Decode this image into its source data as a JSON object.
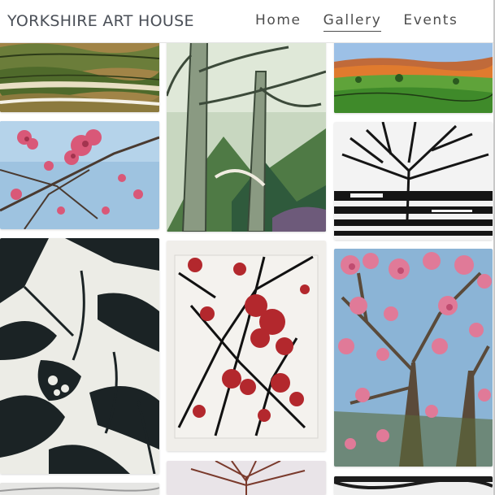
{
  "site": {
    "title": "YORKSHIRE ART HOUSE"
  },
  "nav": {
    "items": [
      {
        "label": "Home",
        "active": false
      },
      {
        "label": "Gallery",
        "active": true
      },
      {
        "label": "Events",
        "active": false
      }
    ]
  },
  "gallery": {
    "artworks": [
      {
        "name": "artwork-valley-landscape",
        "palette": [
          "#6b7d3a",
          "#c9a26b",
          "#f5f2e8"
        ]
      },
      {
        "name": "artwork-woodland-trees",
        "palette": [
          "#7d9b6a",
          "#2f5a3c",
          "#e8e6dc"
        ]
      },
      {
        "name": "artwork-green-hills",
        "palette": [
          "#5fa33a",
          "#e07b2e",
          "#7aa8d8"
        ]
      },
      {
        "name": "artwork-pink-blossom-sky",
        "palette": [
          "#d95878",
          "#9ec3e0",
          "#6b4a3a"
        ]
      },
      {
        "name": "artwork-linocut-tree",
        "palette": [
          "#151515",
          "#f3f3f3"
        ]
      },
      {
        "name": "artwork-linocut-flower",
        "palette": [
          "#1b2325",
          "#ecece6"
        ]
      },
      {
        "name": "artwork-red-blossom-print",
        "palette": [
          "#b3282d",
          "#111111",
          "#f0eeea"
        ]
      },
      {
        "name": "artwork-blossom-tree",
        "palette": [
          "#e07a98",
          "#8bb4d6",
          "#5a6b3a"
        ]
      },
      {
        "name": "artwork-bottom-left-partial",
        "palette": [
          "#cfcfcf"
        ]
      },
      {
        "name": "artwork-branch-partial",
        "palette": [
          "#7a3a2c",
          "#e9e4e8"
        ]
      },
      {
        "name": "artwork-print-partial",
        "palette": [
          "#1c1c1c",
          "#efefef"
        ]
      }
    ]
  }
}
